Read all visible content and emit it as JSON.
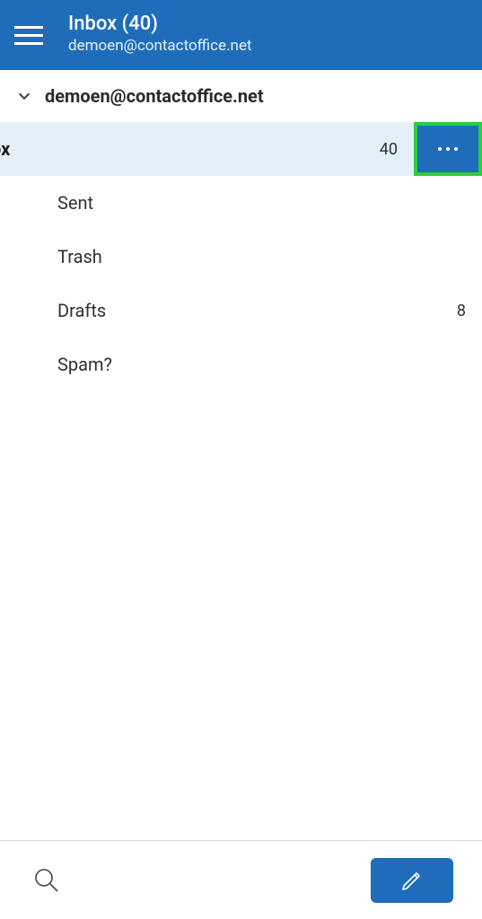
{
  "header": {
    "title": "Inbox (40)",
    "subtitle": "demoen@contactoffice.net"
  },
  "account": {
    "email": "demoen@contactoffice.net"
  },
  "folders": [
    {
      "label": "ox",
      "count": "40",
      "selected": true,
      "showMore": true
    },
    {
      "label": "Sent",
      "count": "",
      "selected": false,
      "showMore": false
    },
    {
      "label": "Trash",
      "count": "",
      "selected": false,
      "showMore": false
    },
    {
      "label": "Drafts",
      "count": "8",
      "selected": false,
      "showMore": false
    },
    {
      "label": "Spam?",
      "count": "",
      "selected": false,
      "showMore": false
    }
  ]
}
